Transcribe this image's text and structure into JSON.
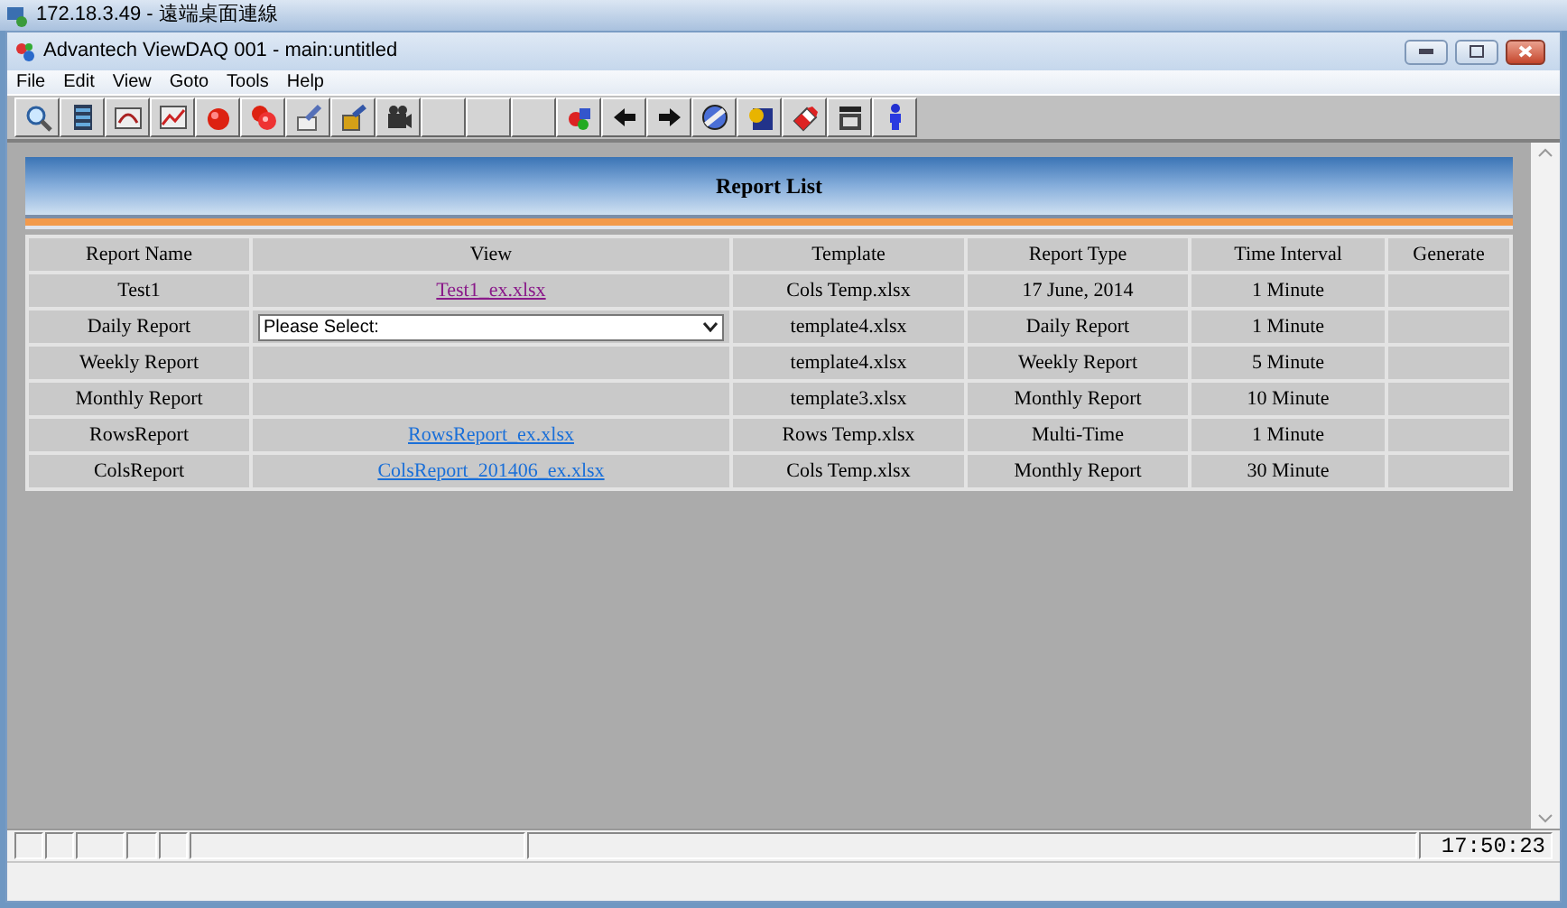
{
  "remote_title": "172.18.3.49 - 遠端桌面連線",
  "window": {
    "title": "Advantech ViewDAQ 001 - main:untitled"
  },
  "menu": [
    "File",
    "Edit",
    "View",
    "Goto",
    "Tools",
    "Help"
  ],
  "report_list": {
    "title": "Report List",
    "columns": [
      "Report Name",
      "View",
      "Template",
      "Report Type",
      "Time Interval",
      "Generate"
    ],
    "rows": [
      {
        "name": "Test1",
        "view": {
          "kind": "link",
          "text": "Test1_ex.xlsx",
          "visited": true
        },
        "template": "Cols Temp.xlsx",
        "type": "17 June, 2014",
        "interval": "1 Minute"
      },
      {
        "name": "Daily Report",
        "view": {
          "kind": "select",
          "text": "Please Select:"
        },
        "template": "template4.xlsx",
        "type": "Daily Report",
        "interval": "1 Minute"
      },
      {
        "name": "Weekly Report",
        "view": {
          "kind": "empty"
        },
        "template": "template4.xlsx",
        "type": "Weekly Report",
        "interval": "5 Minute"
      },
      {
        "name": "Monthly Report",
        "view": {
          "kind": "empty"
        },
        "template": "template3.xlsx",
        "type": "Monthly Report",
        "interval": "10 Minute"
      },
      {
        "name": "RowsReport",
        "view": {
          "kind": "link",
          "text": "RowsReport_ex.xlsx",
          "visited": false
        },
        "template": "Rows Temp.xlsx",
        "type": "Multi-Time",
        "interval": "1 Minute"
      },
      {
        "name": "ColsReport",
        "view": {
          "kind": "link",
          "text": "ColsReport_201406_ex.xlsx",
          "visited": false
        },
        "template": "Cols Temp.xlsx",
        "type": "Monthly Report",
        "interval": "30 Minute"
      }
    ]
  },
  "status_bar": {
    "time": "17:50:23"
  }
}
